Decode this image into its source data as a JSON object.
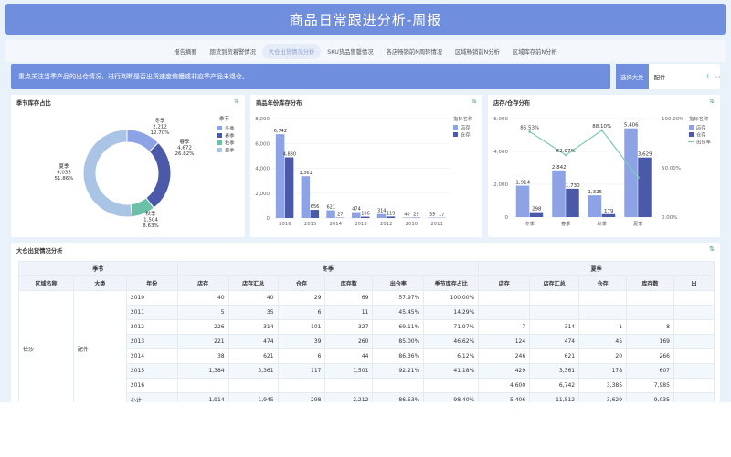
{
  "title": "商品日常跟进分析-周报",
  "tabs": [
    "报告摘要",
    "期货到货着警情况",
    "大仓出货情况分析",
    "SKU货品售罄情况",
    "各店畅销前N周转情况",
    "区域畅销前N分析",
    "区域库存前N分析"
  ],
  "active_tab": 2,
  "notice": "重点关注当季产品的出仓情况，进行判断是否出货速度偏慢或非应季产品未退仓。",
  "category": {
    "label": "选择大类",
    "value": "配件",
    "count": "1"
  },
  "colors": {
    "accent": "#6f8fde",
    "spring": "#4a5aa8",
    "summer": "#a9c4e4",
    "autumn": "#6cc0a8",
    "winter": "#8ea2e6"
  },
  "panel1": {
    "title": "季节库存占比",
    "legend_title": "季节",
    "legend": [
      "冬季",
      "春季",
      "秋季",
      "夏季"
    ],
    "labels": [
      {
        "name": "冬季",
        "value": "2,212",
        "pct": "12.70%"
      },
      {
        "name": "春季",
        "value": "4,672",
        "pct": "26.82%"
      },
      {
        "name": "秋季",
        "value": "1,504",
        "pct": "8.63%"
      },
      {
        "name": "夏季",
        "value": "9,035",
        "pct": "51.86%"
      }
    ]
  },
  "panel2": {
    "title": "商品年份库存分布",
    "legend_title": "指标名称",
    "legend": [
      "店存",
      "仓存"
    ]
  },
  "panel3": {
    "title": "店存/仓存分布",
    "legend_title": "指标名称",
    "legend": [
      "店存",
      "仓存",
      "出仓率"
    ]
  },
  "chart_data": [
    {
      "type": "pie",
      "title": "季节库存占比",
      "categories": [
        "冬季",
        "春季",
        "秋季",
        "夏季"
      ],
      "values": [
        2212,
        4672,
        1504,
        9035
      ]
    },
    {
      "type": "bar",
      "title": "商品年份库存分布",
      "categories": [
        "2016",
        "2015",
        "2014",
        "2013",
        "2012",
        "2010",
        "2011"
      ],
      "series": [
        {
          "name": "店存",
          "values": [
            6742,
            3361,
            621,
            474,
            314,
            40,
            35
          ]
        },
        {
          "name": "仓存",
          "values": [
            4880,
            656,
            27,
            106,
            119,
            29,
            17
          ]
        }
      ],
      "ylim": [
        0,
        8000
      ],
      "yticks": [
        "8,000",
        "6,000",
        "4,000",
        "2,000",
        "0"
      ]
    },
    {
      "type": "bar",
      "title": "店存/仓存分布",
      "categories": [
        "冬季",
        "春季",
        "秋季",
        "夏季"
      ],
      "series": [
        {
          "name": "店存",
          "values": [
            1914,
            2842,
            1325,
            5406
          ]
        },
        {
          "name": "仓存",
          "values": [
            298,
            1730,
            179,
            3629
          ]
        },
        {
          "name": "出仓率",
          "values": [
            86.53,
            62.97,
            88.1,
            40.16
          ],
          "labels": [
            "86.53%",
            "62.97%",
            "88.10%",
            ""
          ]
        }
      ],
      "ylim": [
        0,
        6000
      ],
      "yticks_left": [
        "6,000",
        "4,000",
        "2,000",
        "0"
      ],
      "yticks_right": [
        "100.00%",
        "50.00%",
        "0.00%"
      ]
    }
  ],
  "table": {
    "title": "大仓出货情况分析",
    "season_header": "季节",
    "group_winter": "冬季",
    "group_summer": "夏季",
    "columns": [
      "区域名称",
      "大类",
      "年份",
      "店存",
      "店存汇总",
      "仓存",
      "库存数",
      "出仓率",
      "季节库存占比",
      "店存",
      "店存汇总",
      "仓存",
      "库存数",
      "出"
    ],
    "region": "长沙",
    "category": "配件",
    "rows": [
      [
        "2010",
        "40",
        "40",
        "29",
        "69",
        "57.97%",
        "100.00%",
        "",
        "",
        "",
        "",
        ""
      ],
      [
        "2011",
        "5",
        "35",
        "6",
        "11",
        "45.45%",
        "14.29%",
        "",
        "",
        "",
        "",
        ""
      ],
      [
        "2012",
        "226",
        "314",
        "101",
        "327",
        "69.11%",
        "71.97%",
        "7",
        "314",
        "1",
        "8",
        ""
      ],
      [
        "2013",
        "221",
        "474",
        "39",
        "260",
        "85.00%",
        "46.62%",
        "124",
        "474",
        "45",
        "169",
        ""
      ],
      [
        "2014",
        "38",
        "621",
        "6",
        "44",
        "86.36%",
        "6.12%",
        "246",
        "621",
        "20",
        "266",
        ""
      ],
      [
        "2015",
        "1,384",
        "3,361",
        "117",
        "1,501",
        "92.21%",
        "41.18%",
        "429",
        "3,361",
        "178",
        "607",
        ""
      ],
      [
        "2016",
        "",
        "",
        "",
        "",
        "",
        "",
        "4,600",
        "6,742",
        "3,385",
        "7,985",
        ""
      ],
      [
        "小计",
        "1,914",
        "1,945",
        "298",
        "2,212",
        "86.53%",
        "98.40%",
        "5,406",
        "11,512",
        "3,629",
        "9,035",
        ""
      ]
    ]
  }
}
